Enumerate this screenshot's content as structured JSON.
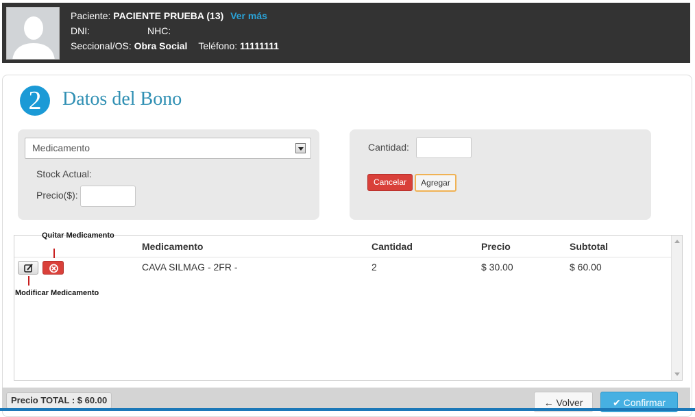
{
  "patient": {
    "label_paciente": "Paciente:",
    "name": "PACIENTE PRUEBA (13)",
    "ver_mas": "Ver más",
    "label_dni": "DNI:",
    "dni": "",
    "label_nhc": "NHC:",
    "nhc": "",
    "label_seccional": "Seccional/OS:",
    "seccional": "Obra Social",
    "label_telefono": "Teléfono:",
    "telefono": "11111111",
    "avatar_icon": "user-silhouette-icon"
  },
  "section": {
    "step": "2",
    "title": "Datos del Bono"
  },
  "form": {
    "medicamento_select": "Medicamento",
    "stock_label": "Stock Actual:",
    "precio_label": "Precio($):",
    "precio_value": "",
    "cantidad_label": "Cantidad:",
    "cantidad_value": "",
    "cancel_label": "Cancelar",
    "add_label": "Agregar"
  },
  "table": {
    "columns": [
      "Medicamento",
      "Cantidad",
      "Precio",
      "Subtotal"
    ],
    "rows": [
      {
        "medicamento": "CAVA SILMAG - 2FR -",
        "cantidad": "2",
        "precio": "$ 30.00",
        "subtotal": "$ 60.00"
      }
    ],
    "annotation_remove": "Quitar Medicamento",
    "annotation_edit": "Modificar Medicamento"
  },
  "footer": {
    "total": "Precio TOTAL : $ 60.00",
    "back_label": "Volver",
    "confirm_label": "Confirmar"
  },
  "colors": {
    "header_bg": "#333333",
    "accent_blue": "#1b9ad6",
    "danger_red": "#d9403a",
    "confirm_blue": "#46b0e2"
  }
}
